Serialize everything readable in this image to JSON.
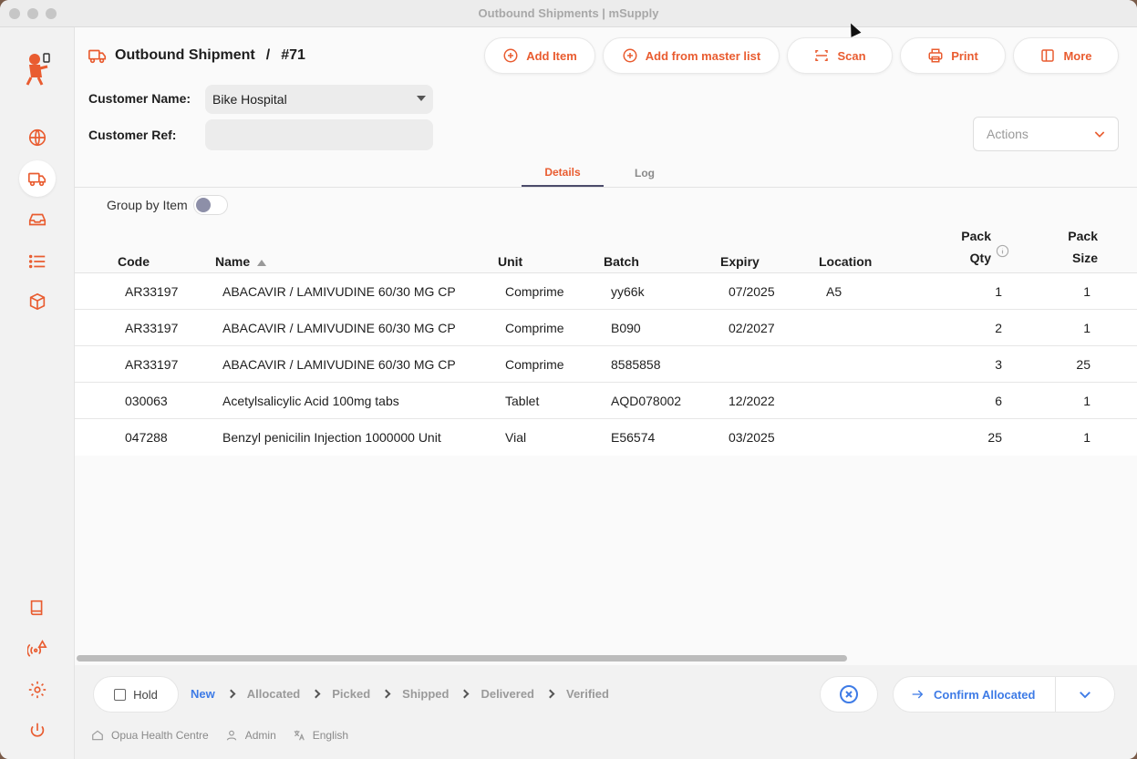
{
  "window": {
    "title": "Outbound Shipments | mSupply"
  },
  "colors": {
    "accent": "#e95c30",
    "primary_blue": "#3e7be6",
    "tab_underline": "#4b4b6b"
  },
  "header": {
    "title": "Outbound Shipment",
    "separator": "/",
    "number": "#71"
  },
  "toolbar": {
    "add_item": "Add Item",
    "add_master": "Add from master list",
    "scan": "Scan",
    "print": "Print",
    "more": "More"
  },
  "form": {
    "customer_name_label": "Customer Name:",
    "customer_name_value": "Bike Hospital",
    "customer_ref_label": "Customer Ref:",
    "customer_ref_value": ""
  },
  "actions": {
    "placeholder": "Actions"
  },
  "tabs": [
    {
      "label": "Details"
    },
    {
      "label": "Log"
    }
  ],
  "group_by_item": {
    "label": "Group by Item",
    "on": false
  },
  "table": {
    "headers": {
      "code": "Code",
      "name": "Name",
      "unit": "Unit",
      "batch": "Batch",
      "expiry": "Expiry",
      "location": "Location",
      "pack_qty_1": "Pack",
      "pack_qty_2": "Qty",
      "pack_size_1": "Pack",
      "pack_size_2": "Size"
    },
    "rows": [
      {
        "code": "AR33197",
        "name": "ABACAVIR / LAMIVUDINE 60/30 MG CP",
        "unit": "Comprime",
        "batch": "yy66k",
        "expiry": "07/2025",
        "location": "A5",
        "pack_qty": "1",
        "pack_size": "1"
      },
      {
        "code": "AR33197",
        "name": "ABACAVIR / LAMIVUDINE 60/30 MG CP",
        "unit": "Comprime",
        "batch": "B090",
        "expiry": "02/2027",
        "location": "",
        "pack_qty": "2",
        "pack_size": "1"
      },
      {
        "code": "AR33197",
        "name": "ABACAVIR / LAMIVUDINE 60/30 MG CP",
        "unit": "Comprime",
        "batch": "8585858",
        "expiry": "",
        "location": "",
        "pack_qty": "3",
        "pack_size": "25"
      },
      {
        "code": "030063",
        "name": "Acetylsalicylic Acid 100mg tabs",
        "unit": "Tablet",
        "batch": "AQD078002",
        "expiry": "12/2022",
        "location": "",
        "pack_qty": "6",
        "pack_size": "1"
      },
      {
        "code": "047288",
        "name": "Benzyl penicilin Injection 1000000 Unit",
        "unit": "Vial",
        "batch": "E56574",
        "expiry": "03/2025",
        "location": "",
        "pack_qty": "25",
        "pack_size": "1"
      }
    ]
  },
  "footer": {
    "hold_label": "Hold",
    "steps": [
      "New",
      "Allocated",
      "Picked",
      "Shipped",
      "Delivered",
      "Verified"
    ],
    "confirm_label": "Confirm Allocated",
    "store": "Opua Health Centre",
    "user": "Admin",
    "language": "English"
  }
}
